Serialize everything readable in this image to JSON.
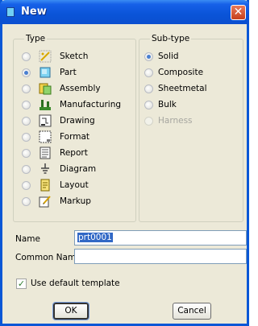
{
  "window": {
    "title": "New",
    "close_glyph": "✕"
  },
  "type_group": {
    "title": "Type",
    "options": [
      {
        "label": "Sketch",
        "icon": "sketch-icon",
        "checked": false
      },
      {
        "label": "Part",
        "icon": "part-icon",
        "checked": true
      },
      {
        "label": "Assembly",
        "icon": "assembly-icon",
        "checked": false
      },
      {
        "label": "Manufacturing",
        "icon": "manufacturing-icon",
        "checked": false
      },
      {
        "label": "Drawing",
        "icon": "drawing-icon",
        "checked": false
      },
      {
        "label": "Format",
        "icon": "format-icon",
        "checked": false
      },
      {
        "label": "Report",
        "icon": "report-icon",
        "checked": false
      },
      {
        "label": "Diagram",
        "icon": "diagram-icon",
        "checked": false
      },
      {
        "label": "Layout",
        "icon": "layout-icon",
        "checked": false
      },
      {
        "label": "Markup",
        "icon": "markup-icon",
        "checked": false
      }
    ]
  },
  "subtype_group": {
    "title": "Sub-type",
    "options": [
      {
        "label": "Solid",
        "checked": true,
        "disabled": false
      },
      {
        "label": "Composite",
        "checked": false,
        "disabled": false
      },
      {
        "label": "Sheetmetal",
        "checked": false,
        "disabled": false
      },
      {
        "label": "Bulk",
        "checked": false,
        "disabled": false
      },
      {
        "label": "Harness",
        "checked": false,
        "disabled": true
      }
    ]
  },
  "fields": {
    "name_label": "Name",
    "name_value": "prt0001",
    "common_name_label": "Common Name",
    "common_name_value": ""
  },
  "default_template": {
    "label": "Use default template",
    "checked": true,
    "check_glyph": "✓"
  },
  "buttons": {
    "ok": "OK",
    "cancel": "Cancel"
  },
  "colors": {
    "title_bar": "#0a54d8",
    "dialog_bg": "#ece9d8",
    "selection": "#3168c6"
  }
}
